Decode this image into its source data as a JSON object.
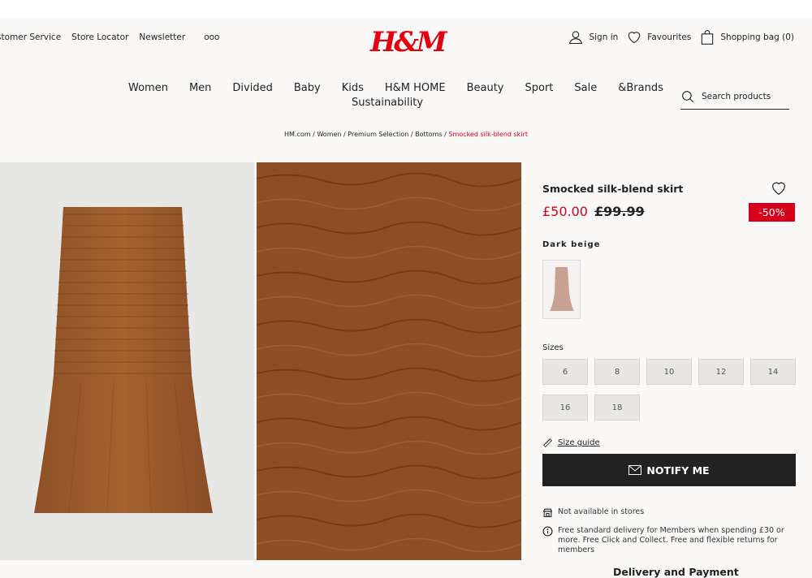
{
  "header": {
    "top_links": [
      "stomer Service",
      "Store Locator",
      "Newsletter",
      "ooo"
    ],
    "logo": "H&M",
    "sign_in": "Sign in",
    "favourites": "Favourites",
    "shopping_bag": "Shopping bag (0)"
  },
  "nav": {
    "items": [
      "Women",
      "Men",
      "Divided",
      "Baby",
      "Kids",
      "H&M HOME",
      "Beauty",
      "Sport",
      "Sale",
      "&Brands"
    ],
    "second_line": "Sustainability"
  },
  "search": {
    "placeholder": "Search products"
  },
  "breadcrumb": {
    "items": [
      "HM.com",
      "Women",
      "Premium Selection",
      "Bottoms"
    ],
    "current": "Smocked silk-blend skirt",
    "separator": "/"
  },
  "product": {
    "title": "Smocked silk-blend skirt",
    "price": "£50.00",
    "old_price": "£99.99",
    "discount": "-50%",
    "color_name": "Dark beige",
    "sizes_label": "Sizes",
    "sizes": [
      "6",
      "8",
      "10",
      "12",
      "14",
      "16",
      "18"
    ],
    "size_guide": "Size guide",
    "notify_button": "NOTIFY ME",
    "availability": "Not available in stores",
    "delivery_info": "Free standard delivery for Members when spending £30 or more. Free Click and Collect. Free and flexible returns for members",
    "delivery_title": "Delivery and Payment"
  },
  "colors": {
    "brand_red": "#e50010",
    "price_red": "#d6001c",
    "skirt_brown": "#9a5a2f",
    "button_dark": "#222222"
  },
  "icons": [
    "user-icon",
    "heart-icon",
    "bag-icon",
    "search-icon",
    "ruler-icon",
    "envelope-icon",
    "store-icon",
    "info-icon"
  ]
}
